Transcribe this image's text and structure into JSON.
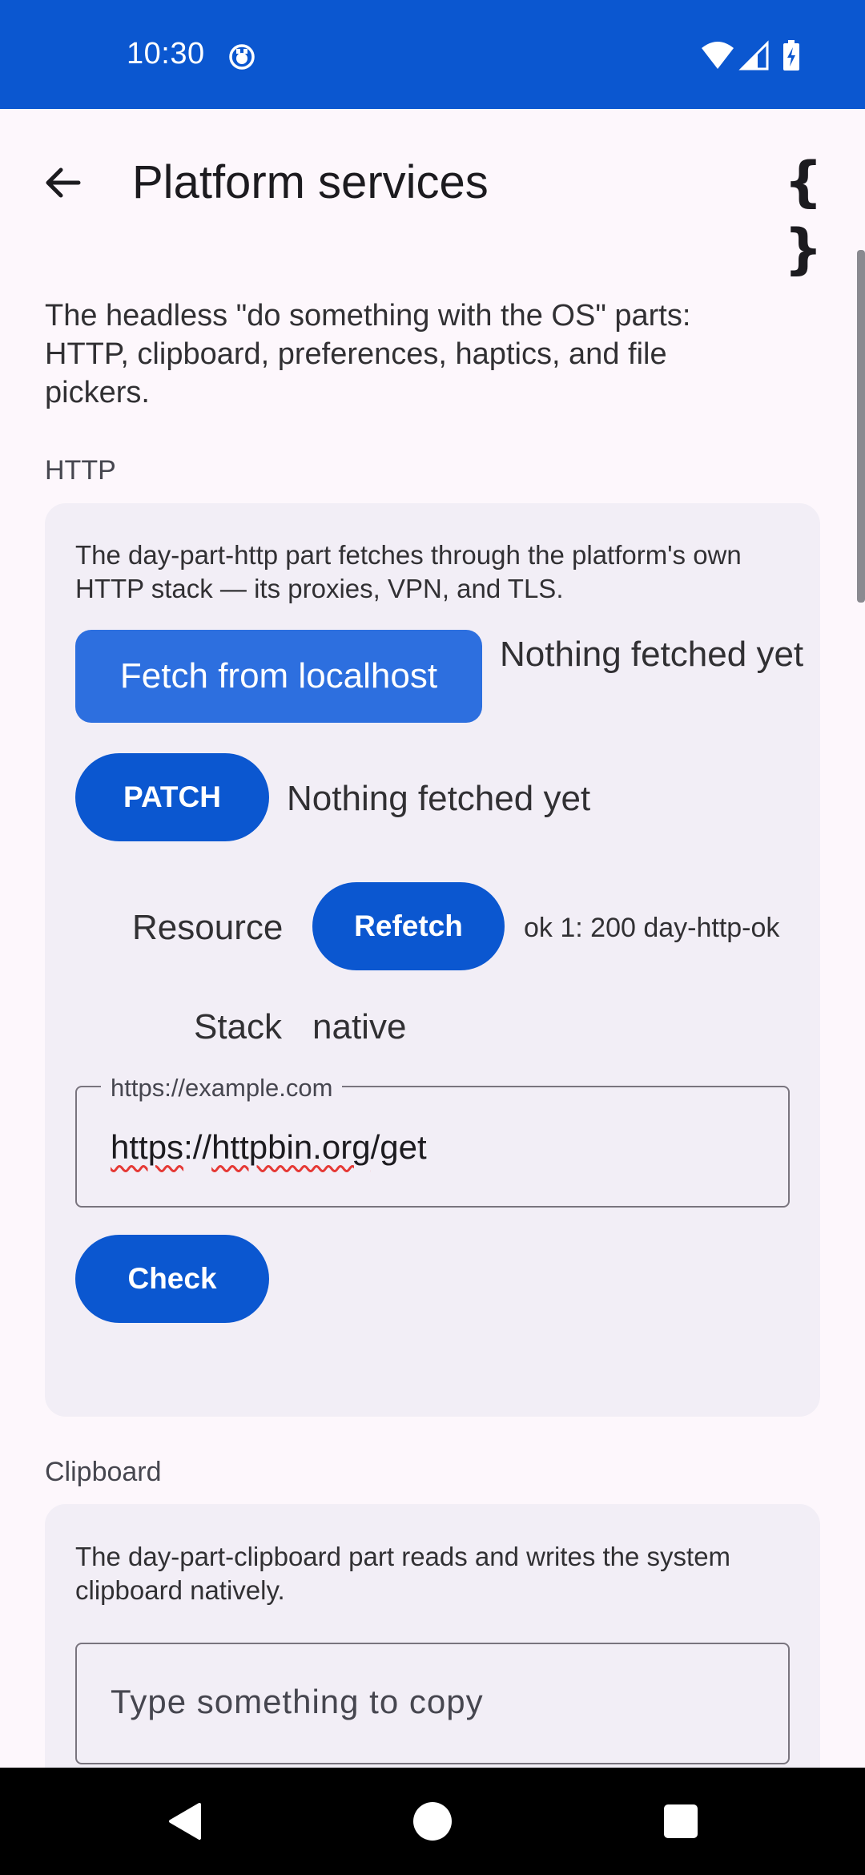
{
  "status_bar": {
    "time": "10:30",
    "icons": [
      "notification-icon",
      "wifi-icon",
      "cellular-icon",
      "battery-charging-icon"
    ],
    "color": "#0b57d0"
  },
  "app_bar": {
    "title": "Platform services",
    "back_icon": "arrow-back-icon",
    "action_icon": "braces-icon",
    "action_label": "{ }"
  },
  "intro": "The headless \"do something with the OS\" parts: HTTP, clipboard, preferences, haptics, and file pickers.",
  "http": {
    "section_label": "HTTP",
    "description": "The day-part-http part fetches through the platform's own HTTP stack — its proxies, VPN, and TLS.",
    "fetch_button": "Fetch from localhost",
    "fetch_status": "Nothing fetched yet",
    "patch_button": "PATCH",
    "patch_status": "Nothing fetched yet",
    "resource_label": "Resource",
    "refetch_button": "Refetch",
    "refetch_status": "ok 1: 200 day-http-ok",
    "stack_label": "Stack",
    "stack_value": "native",
    "url_field": {
      "label": "https://example.com",
      "value_parts": [
        "https",
        "://",
        "httpbin.org",
        "/get"
      ]
    },
    "check_button": "Check"
  },
  "clipboard": {
    "section_label": "Clipboard",
    "description": "The day-part-clipboard part reads and writes the system clipboard natively.",
    "input_placeholder": "Type something to copy"
  },
  "nav_bar": {
    "icons": [
      "nav-back-icon",
      "nav-home-icon",
      "nav-recents-icon"
    ]
  }
}
